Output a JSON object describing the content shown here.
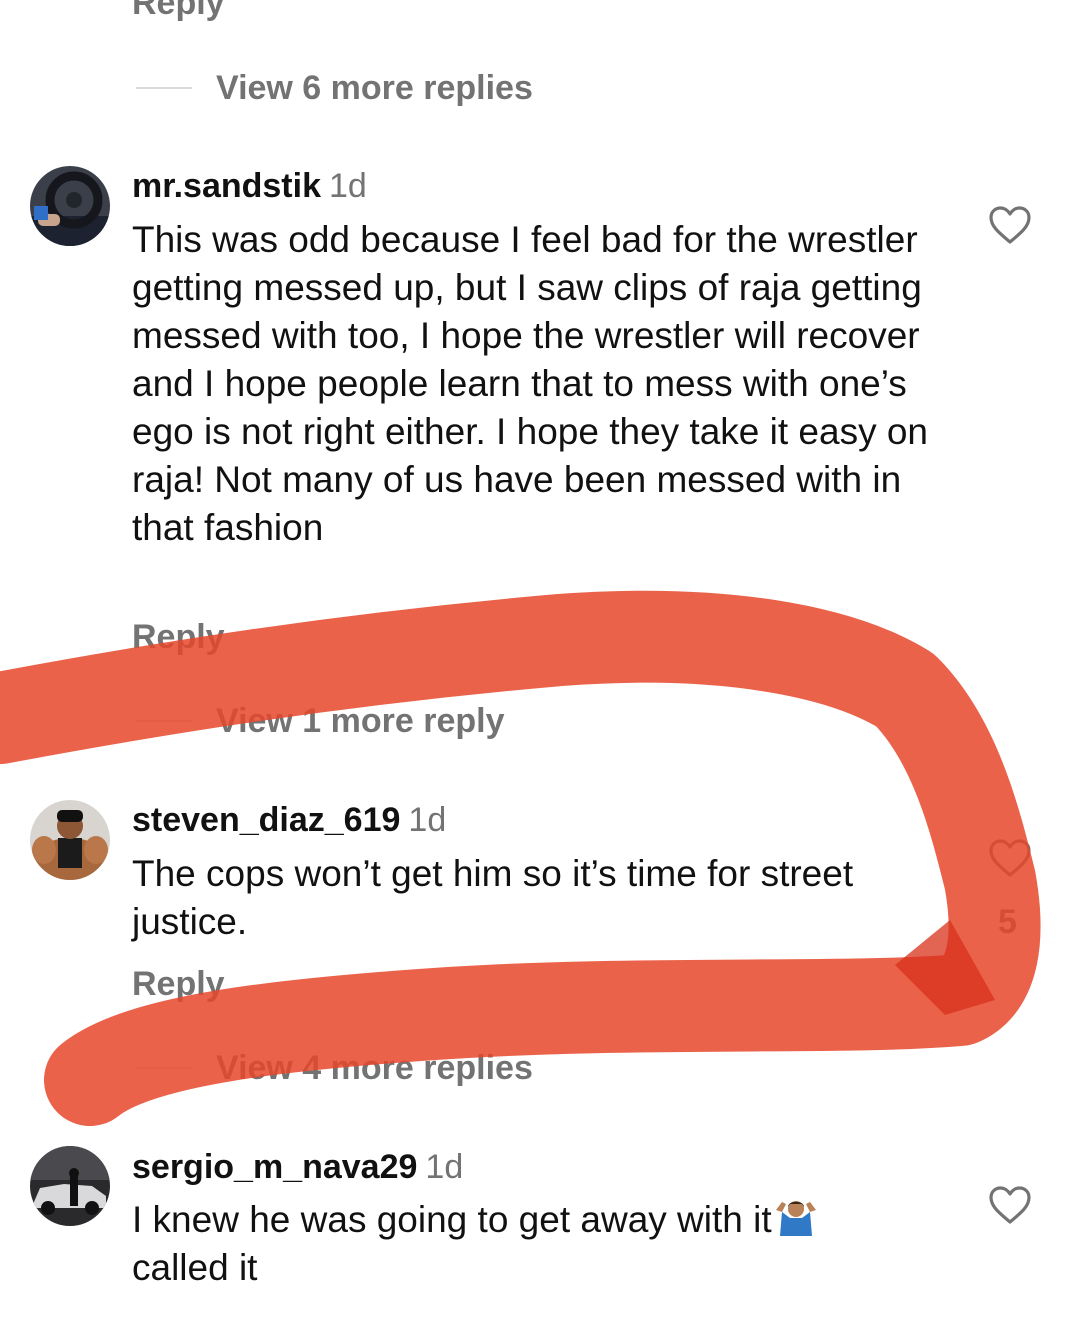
{
  "prev_reply_label": "Reply",
  "threads": [
    {
      "view_replies_label": "View 6 more replies"
    },
    {
      "view_replies_label": "View 1 more reply"
    },
    {
      "view_replies_label": "View 4 more replies"
    }
  ],
  "comments": [
    {
      "username": "mr.sandstik",
      "time": "1d",
      "text": "This was odd because I feel bad for the wrestler getting messed up, but I saw clips of raja getting messed with too, I hope the wrestler will recover and I hope people learn that to mess with one’s ego is not right either. I hope they take it easy on raja! Not many of us have been messed with in that fashion",
      "reply_label": "Reply",
      "avatar_icon": "steering-wheel-photo"
    },
    {
      "username": "steven_diaz_619",
      "time": "1d",
      "text": "The cops won’t get him so it’s time for street justice.",
      "reply_label": "Reply",
      "like_count": "5",
      "avatar_icon": "bodybuilder-photo"
    },
    {
      "username": "sergio_m_nava29",
      "time": "1d",
      "text": "I knew he was going to get away with it",
      "text_line2": "called it",
      "trailing_emoji": "person-shrugging-emoji",
      "avatar_icon": "car-photo"
    }
  ],
  "colors": {
    "muted": "#737373",
    "text": "#111111",
    "annotation": "#e8472b"
  }
}
